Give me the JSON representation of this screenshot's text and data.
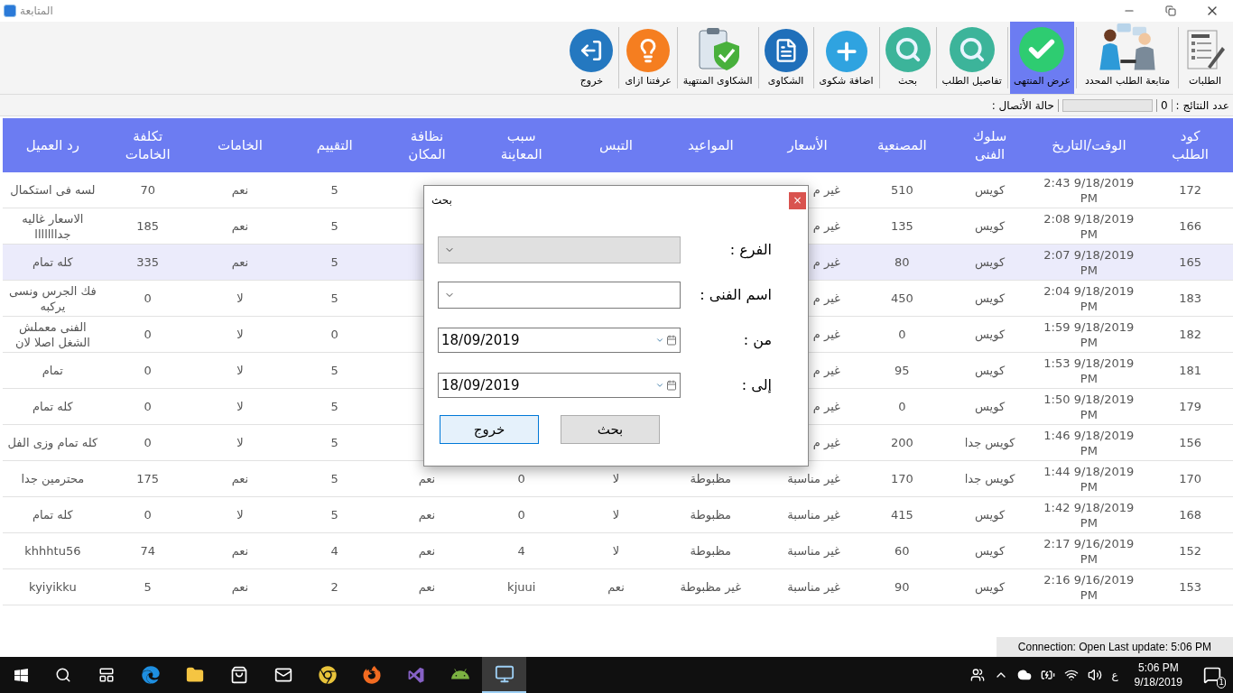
{
  "window": {
    "title": "المتابعة"
  },
  "toolbar": [
    {
      "label": "الطلبات",
      "kind": "orders",
      "selected": false
    },
    {
      "label": "متابعة الطلب المحدد",
      "kind": "people",
      "selected": false
    },
    {
      "label": "عرض المنتهى",
      "kind": "check",
      "selected": true
    },
    {
      "label": "تفاصيل الطلب",
      "kind": "magnifier",
      "selected": false
    },
    {
      "label": "بحث",
      "kind": "magnifier",
      "selected": false
    },
    {
      "label": "اضافة شكوى",
      "kind": "plus",
      "selected": false
    },
    {
      "label": "الشكاوى",
      "kind": "document",
      "selected": false
    },
    {
      "label": "الشكاوى المنتهية",
      "kind": "clipboard",
      "selected": false
    },
    {
      "label": "عرفتنا ازاى",
      "kind": "bulb",
      "selected": false
    },
    {
      "label": "خروج",
      "kind": "exit",
      "selected": false
    }
  ],
  "status": {
    "results_label": "عدد النتائج :",
    "results_count": "0",
    "progress": {
      "level": 0
    },
    "connection_label": "حالة الأتصال :"
  },
  "table": {
    "columns": [
      "كود الطلب",
      "الوقت/التاريخ",
      "سلوك الفنى",
      "المصنعية",
      "الأسعار",
      "المواعيد",
      "التبس",
      "سبب المعاينة",
      "نظافة المكان",
      "التقييم",
      "الخامات",
      "تكلفة الخامات",
      "رد العميل"
    ],
    "rows": [
      {
        "selected": false,
        "cells": [
          "172",
          "2:43 9/18/2019 PM",
          "كويس",
          "510",
          "غير م",
          "",
          "",
          "",
          "",
          "5",
          "نعم",
          "70",
          "لسه فى استكمال"
        ]
      },
      {
        "selected": false,
        "cells": [
          "166",
          "2:08 9/18/2019 PM",
          "كويس",
          "135",
          "غير م",
          "",
          "",
          "",
          "",
          "5",
          "نعم",
          "185",
          "الاسعار غاليه جدااااااا"
        ]
      },
      {
        "selected": true,
        "cells": [
          "165",
          "2:07 9/18/2019 PM",
          "كويس",
          "80",
          "غير م",
          "",
          "",
          "",
          "",
          "5",
          "نعم",
          "335",
          "كله تمام"
        ]
      },
      {
        "selected": false,
        "cells": [
          "183",
          "2:04 9/18/2019 PM",
          "كويس",
          "450",
          "غير م",
          "",
          "",
          "",
          "",
          "5",
          "لا",
          "0",
          "فك الجرس ونسى يركبه"
        ]
      },
      {
        "selected": false,
        "cells": [
          "182",
          "1:59 9/18/2019 PM",
          "كويس",
          "0",
          "غير م",
          "",
          "",
          "",
          "",
          "0",
          "لا",
          "0",
          "الفنى معملش الشغل اصلا لان"
        ]
      },
      {
        "selected": false,
        "cells": [
          "181",
          "1:53 9/18/2019 PM",
          "كويس",
          "95",
          "غير م",
          "",
          "",
          "",
          "",
          "5",
          "لا",
          "0",
          "تمام"
        ]
      },
      {
        "selected": false,
        "cells": [
          "179",
          "1:50 9/18/2019 PM",
          "كويس",
          "0",
          "غير م",
          "",
          "",
          "",
          "",
          "5",
          "لا",
          "0",
          "كله تمام"
        ]
      },
      {
        "selected": false,
        "cells": [
          "156",
          "1:46 9/18/2019 PM",
          "كويس جدا",
          "200",
          "غير م",
          "",
          "",
          "",
          "",
          "5",
          "لا",
          "0",
          "كله تمام وزى الفل"
        ]
      },
      {
        "selected": false,
        "cells": [
          "170",
          "1:44 9/18/2019 PM",
          "كويس جدا",
          "170",
          "غير مناسبة",
          "مظبوطة",
          "لا",
          "0",
          "نعم",
          "5",
          "نعم",
          "175",
          "محترمين جدا"
        ]
      },
      {
        "selected": false,
        "cells": [
          "168",
          "1:42 9/18/2019 PM",
          "كويس",
          "415",
          "غير مناسبة",
          "مظبوطة",
          "لا",
          "0",
          "نعم",
          "5",
          "لا",
          "0",
          "كله تمام"
        ]
      },
      {
        "selected": false,
        "cells": [
          "152",
          "2:17 9/16/2019 PM",
          "كويس",
          "60",
          "غير مناسبة",
          "مظبوطة",
          "لا",
          "4",
          "نعم",
          "4",
          "نعم",
          "74",
          "khhhtu56"
        ]
      },
      {
        "selected": false,
        "cells": [
          "153",
          "2:16 9/16/2019 PM",
          "كويس",
          "90",
          "غير مناسبة",
          "غير مظبوطة",
          "نعم",
          "kjuui",
          "نعم",
          "2",
          "نعم",
          "5",
          "kyiyikku"
        ]
      }
    ]
  },
  "dialog": {
    "title": "بحث",
    "close": "×",
    "fields": [
      {
        "label": "الفرع :",
        "kind": "combo",
        "disabled": true
      },
      {
        "label": "اسم الفنى :",
        "kind": "combo",
        "disabled": false
      },
      {
        "label": "من :",
        "kind": "date",
        "value": "18/09/2019",
        "disabled": false
      },
      {
        "label": "إلى :",
        "kind": "date",
        "value": "18/09/2019",
        "disabled": false
      }
    ],
    "buttons": [
      {
        "label": "بحث",
        "focused": false
      },
      {
        "label": "خروج",
        "focused": true
      }
    ]
  },
  "footer_status": "Connection: Open Last update: 5:06 PM",
  "taskbar": {
    "apps": [
      {
        "kind": "edge",
        "active": false
      },
      {
        "kind": "folder",
        "active": false
      },
      {
        "kind": "store",
        "active": false
      },
      {
        "kind": "mail",
        "active": false
      },
      {
        "kind": "chrome",
        "active": false
      },
      {
        "kind": "firefox",
        "active": false
      },
      {
        "kind": "vs",
        "active": false
      },
      {
        "kind": "android",
        "active": false
      },
      {
        "kind": "monitor",
        "active": true
      }
    ],
    "language": "ع",
    "time": "5:06 PM",
    "date": "9/18/2019",
    "notifications": "1"
  }
}
